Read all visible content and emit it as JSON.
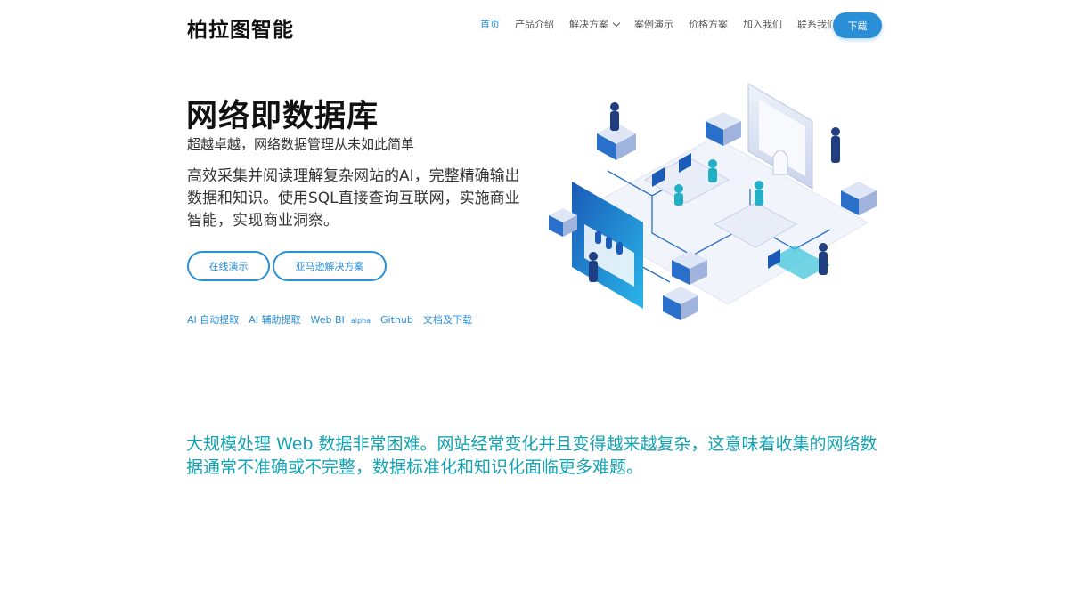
{
  "header": {
    "logo": "柏拉图智能",
    "nav": [
      {
        "label": "首页",
        "active": true
      },
      {
        "label": "产品介绍"
      },
      {
        "label": "解决方案",
        "dropdown": true
      },
      {
        "label": "案例演示"
      },
      {
        "label": "价格方案"
      },
      {
        "label": "加入我们"
      },
      {
        "label": "联系我们"
      }
    ],
    "download_label": "下载"
  },
  "hero": {
    "title": "网络即数据库",
    "subtitle": "超越卓越，网络数据管理从未如此简单",
    "description": "高效采集并阅读理解复杂网站的AI，完整精确输出数据和知识。使用SQL直接查询互联网，实施商业智能，实现商业洞察。",
    "buttons": {
      "demo": "在线演示",
      "amazon": "亚马逊解决方案"
    },
    "links": {
      "ai_extract": "AI 自动提取",
      "ai_assist": "AI 辅助提取",
      "web_bi": "Web BI",
      "web_bi_tag": "alpha",
      "github": "Github",
      "docs": "文档及下载"
    }
  },
  "statement": "大规模处理 Web 数据非常困难。网站经常变化并且变得越来越复杂，这意味着收集的网络数据通常不准确或不完整，数据标准化和知识化面临更多难题。",
  "colors": {
    "accent": "#2a8fd6",
    "teal": "#14a3b3",
    "title": "#111111"
  }
}
